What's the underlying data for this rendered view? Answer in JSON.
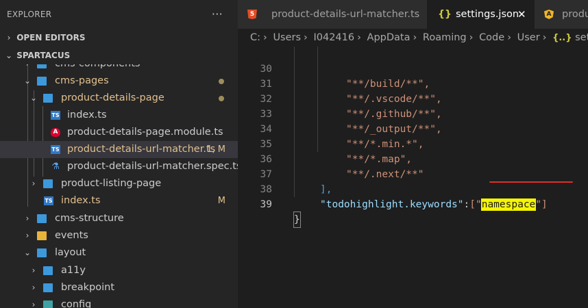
{
  "sidebar": {
    "explorer_title": "EXPLORER",
    "more_label": "···",
    "open_editors_label": "OPEN EDITORS",
    "workspace_label": "SPARTACUS",
    "tree": [
      {
        "label": "cms-components",
        "icon": "folder-icon",
        "color": "#cccccc",
        "deco": ""
      },
      {
        "label": "cms-pages",
        "icon": "folder-open-icon",
        "color": "#e2c08d",
        "deco": "•"
      },
      {
        "label": "product-details-page",
        "icon": "folder-open-icon",
        "color": "#e2c08d",
        "deco": "•"
      },
      {
        "label": "index.ts",
        "icon": "typescript-icon",
        "color": "#cccccc",
        "deco": ""
      },
      {
        "label": "product-details-page.module.ts",
        "icon": "angular-icon",
        "color": "#cccccc",
        "deco": ""
      },
      {
        "label": "product-details-url-matcher.ts",
        "icon": "typescript-icon",
        "color": "#e2c08d",
        "deco": "1, M"
      },
      {
        "label": "product-details-url-matcher.spec.ts",
        "icon": "test-flask-icon",
        "color": "#cccccc",
        "deco": ""
      },
      {
        "label": "product-listing-page",
        "icon": "folder-icon",
        "color": "#cccccc",
        "deco": ""
      },
      {
        "label": "index.ts",
        "icon": "typescript-icon",
        "color": "#e2c08d",
        "deco": "M"
      },
      {
        "label": "cms-structure",
        "icon": "folder-icon",
        "color": "#cccccc",
        "deco": ""
      },
      {
        "label": "events",
        "icon": "folder-events-icon",
        "color": "#cccccc",
        "deco": ""
      },
      {
        "label": "layout",
        "icon": "folder-layout-icon",
        "color": "#cccccc",
        "deco": ""
      },
      {
        "label": "a11y",
        "icon": "folder-icon",
        "color": "#cccccc",
        "deco": ""
      },
      {
        "label": "breakpoint",
        "icon": "folder-icon",
        "color": "#cccccc",
        "deco": ""
      },
      {
        "label": "config",
        "icon": "folder-config-icon",
        "color": "#cccccc",
        "deco": ""
      }
    ]
  },
  "tabs": [
    {
      "label": "product-details-url-matcher.ts",
      "icon": "html-icon",
      "active": false
    },
    {
      "label": "settings.json",
      "icon": "json-icon",
      "active": true,
      "close": "✕"
    },
    {
      "label": "produ",
      "icon": "angular-icon",
      "active": false
    }
  ],
  "breadcrumb": {
    "items": [
      "C:",
      "Users",
      "I042416",
      "AppData",
      "Roaming",
      "Code",
      "User"
    ],
    "json_icon": "{..}",
    "last": "settings."
  },
  "code": {
    "lines": [
      {
        "n": "30",
        "text": "\"**/build/**\","
      },
      {
        "n": "31",
        "text": "\"**/.vscode/**\","
      },
      {
        "n": "32",
        "text": "\"**/.github/**\","
      },
      {
        "n": "33",
        "text": "\"**/_output/**\","
      },
      {
        "n": "34",
        "text": "\"**/*.min.*\","
      },
      {
        "n": "35",
        "text": "\"**/*.map\","
      },
      {
        "n": "36",
        "text": "\"**/.next/**\""
      },
      {
        "n": "37",
        "text": "],"
      },
      {
        "n": "38",
        "key": "\"todohighlight.keywords\"",
        "colon": ":",
        "open": "[\"",
        "highlight": "namespace",
        "close": "\"]"
      },
      {
        "n": "39",
        "text": "}"
      }
    ]
  },
  "colors": {
    "modified": "#e2c08d",
    "highlight": "#f5f500",
    "underline": "#e0302a"
  }
}
